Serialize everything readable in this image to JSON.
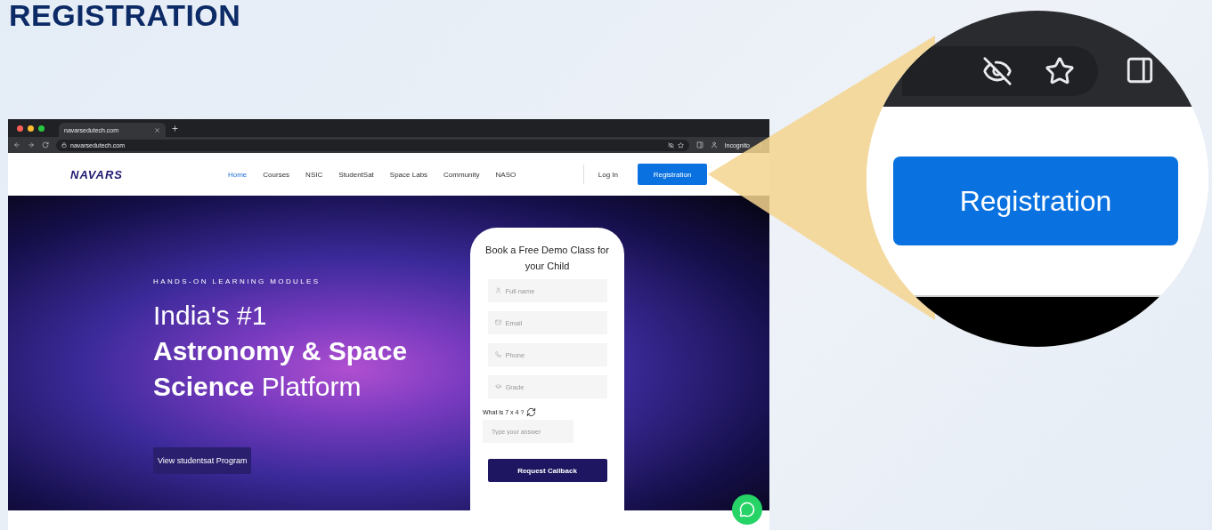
{
  "page_title": "REGISTRATION",
  "browser": {
    "tab_title": "navarsedutech.com",
    "url": "navarsedutech.com",
    "profile_label": "Incognito"
  },
  "site": {
    "logo": "NAVARS",
    "nav": [
      {
        "label": "Home",
        "selected": true
      },
      {
        "label": "Courses",
        "selected": false
      },
      {
        "label": "NSIC",
        "selected": false
      },
      {
        "label": "StudentSat",
        "selected": false
      },
      {
        "label": "Space Labs",
        "selected": false
      },
      {
        "label": "Community",
        "selected": false
      },
      {
        "label": "NASO",
        "selected": false
      }
    ],
    "login": "Log In",
    "register": "Registration"
  },
  "hero": {
    "eyebrow": "HANDS-ON LEARNING MODULES",
    "headline": [
      "India's #1",
      "**Astronomy & Space**",
      "**Science** Platform"
    ],
    "cta": "View studentsat Program"
  },
  "form": {
    "title": "Book a Free Demo Class for your Child",
    "fields": [
      {
        "kind": "person",
        "placeholder": "Full name"
      },
      {
        "kind": "mail",
        "placeholder": "Email"
      },
      {
        "kind": "phone",
        "placeholder": "Phone"
      },
      {
        "kind": "grade",
        "placeholder": "Grade"
      }
    ],
    "captcha_question": "What is 7 x 4 ?",
    "captcha_placeholder": "Type your answer",
    "submit": "Request Callback"
  },
  "callout": {
    "button": "Registration"
  }
}
